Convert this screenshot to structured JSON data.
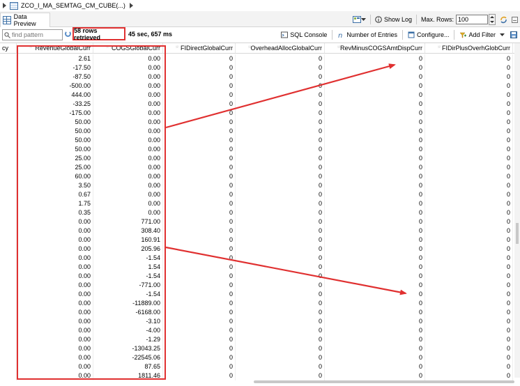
{
  "breadcrumb": {
    "path": "ZCO_I_MA_SEMTAG_CM_CUBE(...)"
  },
  "tab": {
    "label": "Data Preview"
  },
  "tabtools": {
    "show_log": "Show Log",
    "max_rows_label": "Max. Rows:",
    "max_rows_value": "100"
  },
  "toolbar": {
    "search_placeholder": "find pattern",
    "rows_retrieved": "58 rows retrieved",
    "time": "45 sec, 657 ms",
    "sql_console": "SQL Console",
    "number_of_entries": "Number of Entries",
    "configure": "Configure...",
    "add_filter": "Add Filter"
  },
  "table": {
    "columns": [
      "cy",
      "RevenueGlobalCurr",
      "COGSGlobalCurr",
      "FIDirectGlobalCurr",
      "OverheadAllocGlobalCurr",
      "RevMinusCOGSAmtDispCurr",
      "FIDirPlusOverhGlobCurr"
    ],
    "revenue": [
      "2.61",
      "-17.50",
      "-87.50",
      "-500.00",
      "444.00",
      "-33.25",
      "-175.00",
      "50.00",
      "50.00",
      "50.00",
      "50.00",
      "25.00",
      "25.00",
      "60.00",
      "3.50",
      "0.67",
      "1.75",
      "0.35",
      "0.00",
      "0.00",
      "0.00",
      "0.00",
      "0.00",
      "0.00",
      "0.00",
      "0.00",
      "0.00",
      "0.00",
      "0.00",
      "0.00",
      "0.00",
      "0.00",
      "0.00",
      "0.00",
      "0.00",
      "0.00"
    ],
    "cogs": [
      "0.00",
      "0.00",
      "0.00",
      "0.00",
      "0.00",
      "0.00",
      "0.00",
      "0.00",
      "0.00",
      "0.00",
      "0.00",
      "0.00",
      "0.00",
      "0.00",
      "0.00",
      "0.00",
      "0.00",
      "0.00",
      "771.00",
      "308.40",
      "160.91",
      "205.96",
      "-1.54",
      "1.54",
      "-1.54",
      "-771.00",
      "-1.54",
      "-11889.00",
      "-6168.00",
      "-3.10",
      "-4.00",
      "-1.29",
      "-13043.25",
      "-22545.06",
      "87.65",
      "1811.46"
    ],
    "zero": "0"
  },
  "colors": {
    "highlight": "#e03030",
    "accent": "#3a6ea5"
  }
}
